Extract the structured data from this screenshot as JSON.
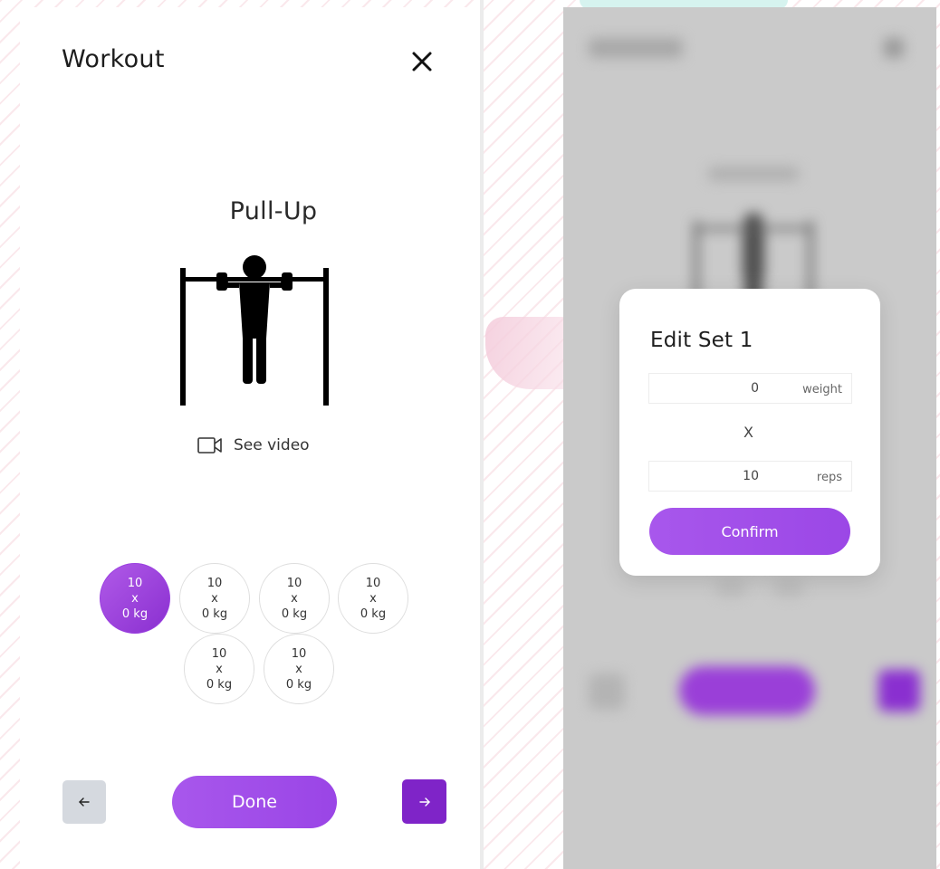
{
  "workout_screen": {
    "title": "Workout",
    "close_icon": "close-icon",
    "exercise": {
      "name": "Pull-Up",
      "illustration_icon": "pull-up-figure-icon"
    },
    "see_video": {
      "icon": "video-camera-icon",
      "label": "See video"
    },
    "sets": [
      {
        "reps": "10",
        "times": "x",
        "weight": "0 kg",
        "active": true
      },
      {
        "reps": "10",
        "times": "x",
        "weight": "0 kg",
        "active": false
      },
      {
        "reps": "10",
        "times": "x",
        "weight": "0 kg",
        "active": false
      },
      {
        "reps": "10",
        "times": "x",
        "weight": "0 kg",
        "active": false
      },
      {
        "reps": "10",
        "times": "x",
        "weight": "0 kg",
        "active": false
      },
      {
        "reps": "10",
        "times": "x",
        "weight": "0 kg",
        "active": false
      }
    ],
    "footer": {
      "prev_icon": "arrow-left-icon",
      "done_label": "Done",
      "next_icon": "arrow-right-icon"
    }
  },
  "edit_set_dialog": {
    "title": "Edit Set 1",
    "weight": {
      "value": "0",
      "unit": "weight"
    },
    "times_sign": "X",
    "reps": {
      "value": "10",
      "unit": "reps"
    },
    "confirm_label": "Confirm"
  },
  "colors": {
    "accent": "#a050e8",
    "accent_dark": "#7f24c8",
    "nav_prev_bg": "#d5d9df",
    "overlay_bg": "#cacaca"
  }
}
